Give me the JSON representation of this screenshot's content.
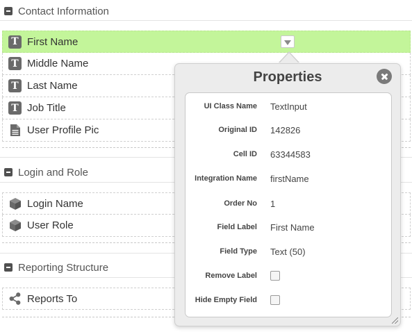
{
  "sections": {
    "contact": {
      "title": "Contact Information"
    },
    "login": {
      "title": "Login and Role"
    },
    "reporting": {
      "title": "Reporting Structure"
    }
  },
  "contact_fields": [
    {
      "label": "First Name",
      "icon": "text-field-icon",
      "selected": true
    },
    {
      "label": "Middle Name",
      "icon": "text-field-icon"
    },
    {
      "label": "Last Name",
      "icon": "text-field-icon"
    },
    {
      "label": "Job Title",
      "icon": "text-field-icon"
    },
    {
      "label": "User Profile Pic",
      "icon": "document-icon"
    }
  ],
  "login_fields": [
    {
      "label": "Login Name",
      "icon": "cube-icon"
    },
    {
      "label": "User Role",
      "icon": "cube-icon"
    }
  ],
  "reporting_fields": [
    {
      "label": "Reports To",
      "icon": "share-icon"
    }
  ],
  "popup": {
    "title": "Properties",
    "properties": [
      {
        "label": "UI Class Name",
        "value": "TextInput"
      },
      {
        "label": "Original ID",
        "value": "142826"
      },
      {
        "label": "Cell ID",
        "value": "63344583"
      },
      {
        "label": "Integration Name",
        "value": "firstName"
      },
      {
        "label": "Order No",
        "value": "1"
      },
      {
        "label": "Field Label",
        "value": "First Name"
      },
      {
        "label": "Field Type",
        "value": "Text (50)"
      },
      {
        "label": "Remove Label",
        "checked": false
      },
      {
        "label": "Hide Empty Field",
        "checked": false
      }
    ]
  },
  "colors": {
    "selected_row": "#c3f59a",
    "icon_gray": "#6a6a6a"
  }
}
